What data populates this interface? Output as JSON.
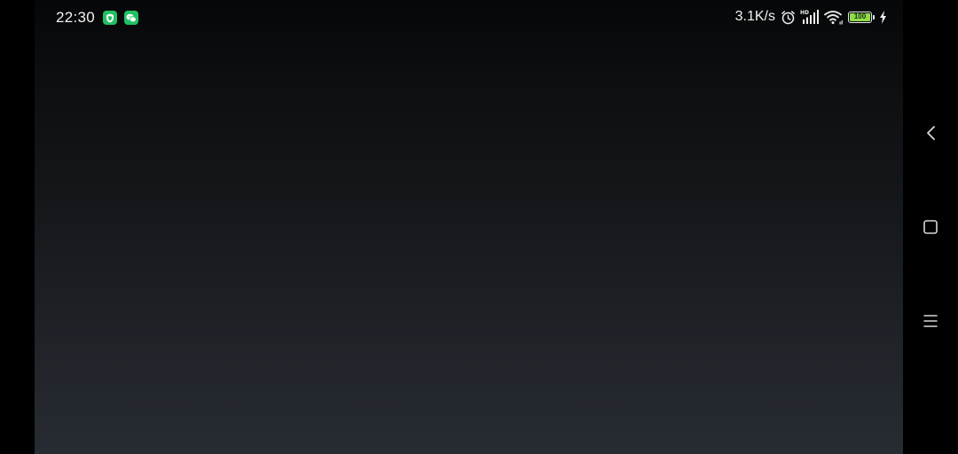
{
  "status_bar": {
    "time": "22:30",
    "network_speed": "3.1K/s",
    "battery_level": "100",
    "notification_icons": [
      "shield-app-icon",
      "wechat-icon"
    ],
    "system_icons": [
      "alarm-icon",
      "hd-signal-icon",
      "wifi-icon",
      "battery-icon",
      "charging-icon"
    ]
  },
  "navigation_bar": {
    "buttons": [
      "back",
      "home",
      "recents"
    ]
  },
  "colors": {
    "background_top": "#060708",
    "background_bottom": "#272b32",
    "badge_green": "#21c063",
    "battery_green": "#8fdc4a"
  }
}
